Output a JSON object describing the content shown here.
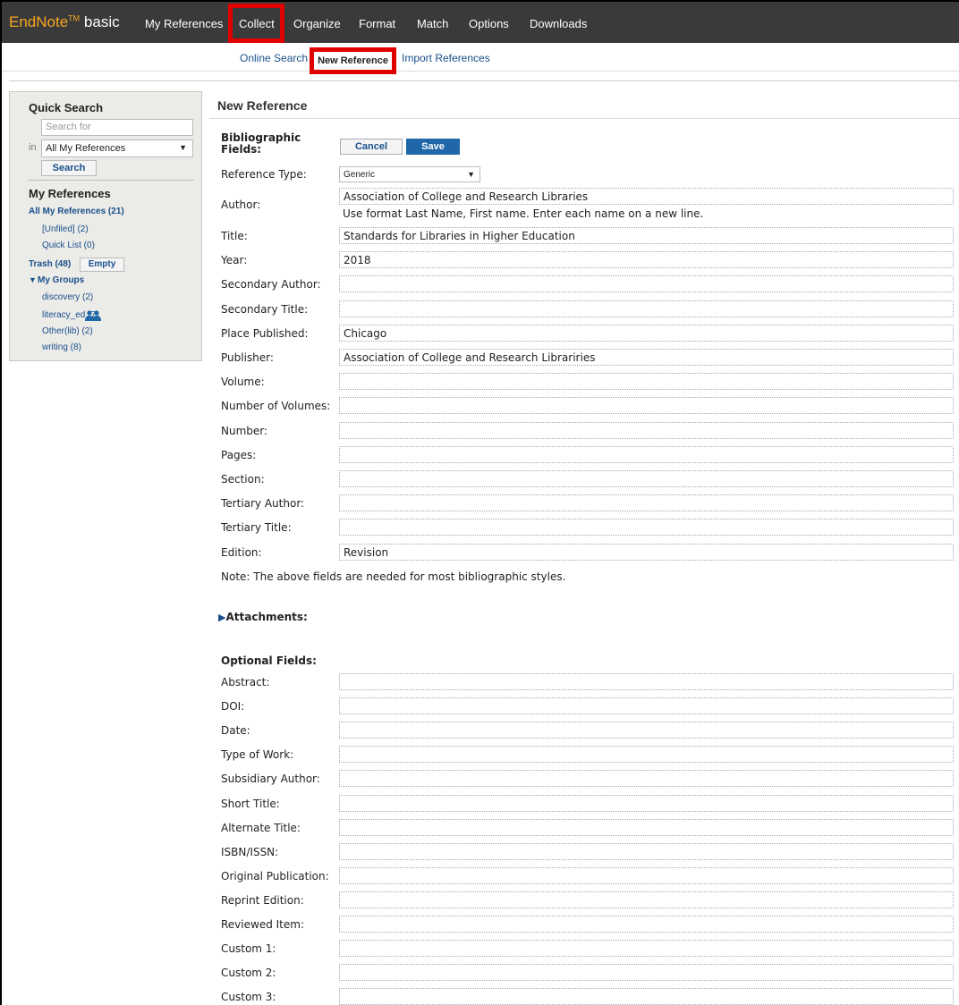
{
  "topnav": {
    "logo_brand": "EndNote",
    "logo_tm": "TM",
    "logo_suffix": "basic",
    "items": [
      "My References",
      "Collect",
      "Organize",
      "Format",
      "Match",
      "Options",
      "Downloads"
    ]
  },
  "subnav": {
    "items": [
      "Online Search",
      "New Reference",
      "Import References"
    ]
  },
  "sidebar": {
    "quick_search_title": "Quick Search",
    "search_placeholder": "Search for",
    "in_label": "in",
    "scope_value": "All My References",
    "search_button": "Search",
    "my_refs_title": "My References",
    "all_refs": "All My References (21)",
    "unfiled": "[Unfiled] (2)",
    "quick_list": "Quick List (0)",
    "trash": "Trash (48)",
    "empty_button": "Empty",
    "groups_label": "My Groups",
    "groups": [
      "discovery (2)",
      "literacy_ed (7)",
      "Other(lib) (2)",
      "writing (8)"
    ]
  },
  "main": {
    "title": "New Reference",
    "bib_label_line1": "Bibliographic",
    "bib_label_line2": "Fields:",
    "cancel_button": "Cancel",
    "save_button": "Save",
    "reftype_label": "Reference Type:",
    "reftype_value": "Generic",
    "author_label": "Author:",
    "author_value": "Association of College and Research Libraries",
    "author_hint": "Use format Last Name, First name. Enter each name on a new line.",
    "fields": [
      {
        "label": "Title:",
        "value": "Standards for Libraries in Higher Education"
      },
      {
        "label": "Year:",
        "value": "2018"
      },
      {
        "label": "Secondary Author:",
        "value": ""
      },
      {
        "label": "Secondary Title:",
        "value": ""
      },
      {
        "label": "Place Published:",
        "value": "Chicago"
      },
      {
        "label": "Publisher:",
        "value": "Association of College and Research Librariries"
      },
      {
        "label": "Volume:",
        "value": ""
      },
      {
        "label": "Number of Volumes:",
        "value": ""
      },
      {
        "label": "Number:",
        "value": ""
      },
      {
        "label": "Pages:",
        "value": ""
      },
      {
        "label": "Section:",
        "value": ""
      },
      {
        "label": "Tertiary Author:",
        "value": ""
      },
      {
        "label": "Tertiary Title:",
        "value": ""
      },
      {
        "label": "Edition:",
        "value": "Revision"
      }
    ],
    "note": "Note: The above fields are needed for most bibliographic styles.",
    "attachments_label": "Attachments:",
    "optional_label": "Optional Fields:",
    "optional_fields": [
      {
        "label": "Abstract:",
        "value": ""
      },
      {
        "label": "DOI:",
        "value": ""
      },
      {
        "label": "Date:",
        "value": ""
      },
      {
        "label": "Type of Work:",
        "value": ""
      },
      {
        "label": "Subsidiary Author:",
        "value": ""
      },
      {
        "label": "Short Title:",
        "value": ""
      },
      {
        "label": "Alternate Title:",
        "value": ""
      },
      {
        "label": "ISBN/ISSN:",
        "value": ""
      },
      {
        "label": "Original Publication:",
        "value": ""
      },
      {
        "label": "Reprint Edition:",
        "value": ""
      },
      {
        "label": "Reviewed Item:",
        "value": ""
      },
      {
        "label": "Custom 1:",
        "value": ""
      },
      {
        "label": "Custom 2:",
        "value": ""
      },
      {
        "label": "Custom 3:",
        "value": ""
      }
    ]
  },
  "colors": {
    "nav_bg": "#3a3a3a",
    "brand": "#f5a623",
    "highlight": "#e00000",
    "link": "#1a4f8b",
    "save_bg": "#1f67a8"
  }
}
